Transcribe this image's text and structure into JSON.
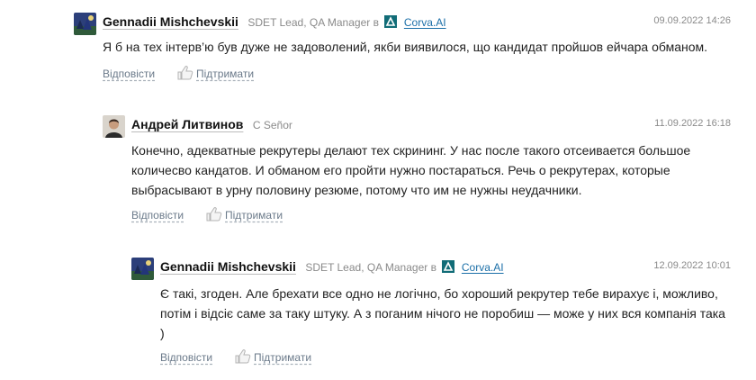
{
  "comments": [
    {
      "author": "Gennadii Mishchevskii",
      "meta": "SDET Lead, QA Manager в",
      "company": "Corva.AI",
      "date": "09.09.2022 14:26",
      "text": "Я б на тех інтерв’ю був дуже не задоволений, якби виявилося, що кандидат пройшов ейчара обманом.",
      "reply_label": "Відповісти",
      "support_label": "Підтримати"
    },
    {
      "author": "Андрей Литвинов",
      "meta": "C Señor",
      "date": "11.09.2022 16:18",
      "text": "Конечно, адекватные рекрутеры делают тех скрининг. У нас после такого отсеивается большое количесво кандатов. И обманом его пройти нужно постараться. Речь о рекрутерах, которые выбрасывают в урну половину резюме, потому что им не нужны неудачники.",
      "reply_label": "Відповісти",
      "support_label": "Підтримати"
    },
    {
      "author": "Gennadii Mishchevskii",
      "meta": "SDET Lead, QA Manager в",
      "company": "Corva.AI",
      "date": "12.09.2022 10:01",
      "text": "Є такі, згоден. Але брехати все одно не логічно, бо хороший рекрутер тебе вирахує і, можливо, потім і відсіє саме за таку штуку. А з поганим нічого не поробиш — може у них вся компанія така )",
      "reply_label": "Відповісти",
      "support_label": "Підтримати"
    }
  ],
  "colors": {
    "author": "#111111",
    "meta": "#8a8a8a",
    "company_link": "#1b6fa8",
    "company_logo": "#116c77",
    "action_link": "#6b7a8a"
  },
  "icons": {
    "avatar_gennadii": "avatar-image",
    "avatar_andrei": "avatar-photo",
    "company": "corva-logo-icon",
    "support": "thumbs-up-icon"
  }
}
